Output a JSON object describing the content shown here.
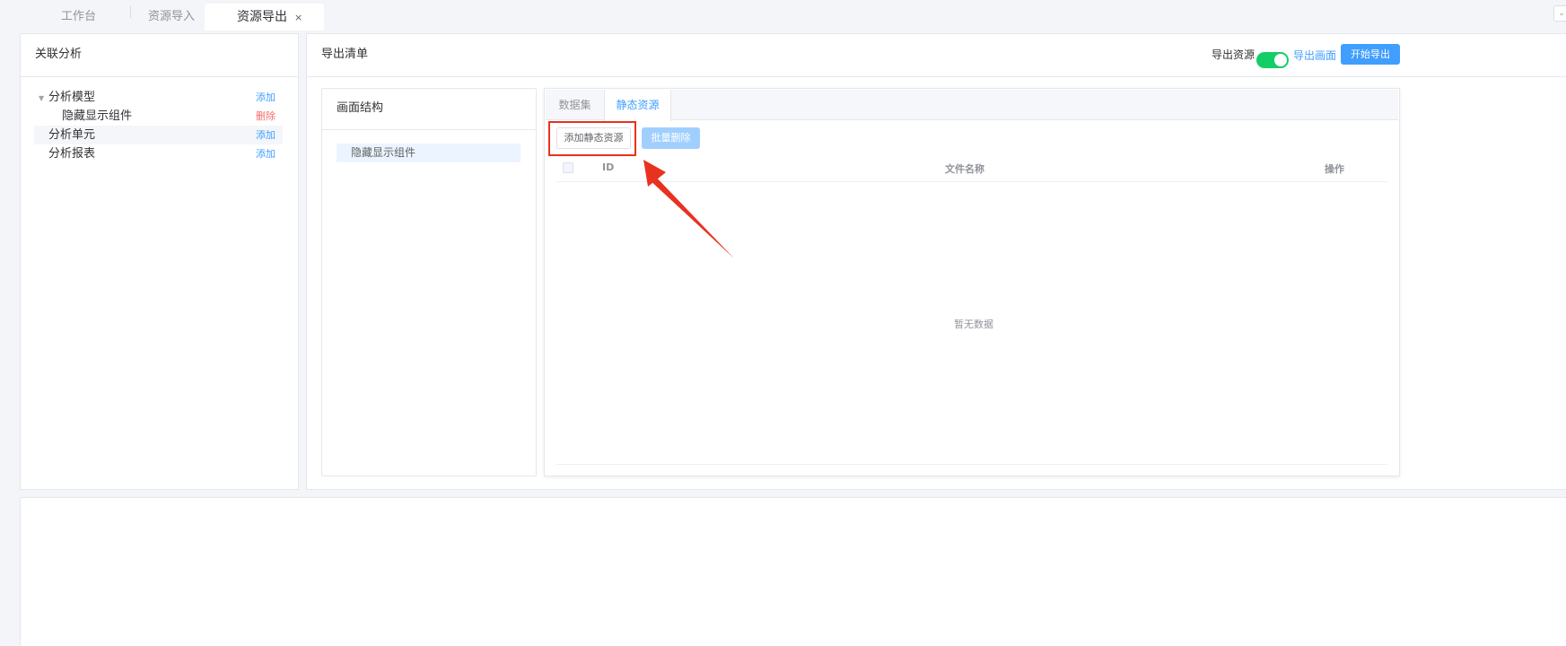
{
  "tabs": [
    {
      "label": "工作台"
    },
    {
      "label": "资源导入"
    },
    {
      "label": "资源导出",
      "close": "×"
    }
  ],
  "tab_dropdown_icon": "chevron-down-icon",
  "left_panel": {
    "title": "关联分析",
    "tree": [
      {
        "label": "分析模型",
        "action": "添加",
        "expanded": true
      },
      {
        "label": "隐藏显示组件",
        "action": "删除"
      },
      {
        "label": "分析单元",
        "action": "添加"
      },
      {
        "label": "分析报表",
        "action": "添加"
      }
    ]
  },
  "main_panel": {
    "title": "导出清单",
    "export_resource_label": "导出资源",
    "export_resource_on": true,
    "export_screen_link": "导出画面",
    "start_export_button": "开始导出"
  },
  "structure_panel": {
    "title": "画面结构",
    "item": "隐藏显示组件"
  },
  "resource_tabs": [
    {
      "label": "数据集"
    },
    {
      "label": "静态资源",
      "active": true
    }
  ],
  "toolbar": {
    "add_static_button": "添加静态资源",
    "batch_delete_button": "批量删除"
  },
  "table": {
    "columns": [
      "ID",
      "文件名称",
      "操作"
    ],
    "empty_text": "暂无数据"
  },
  "colors": {
    "accent": "#409eff",
    "switch_on": "#13ce66",
    "delete": "#f56c6c",
    "annotation": "#e8321e"
  }
}
